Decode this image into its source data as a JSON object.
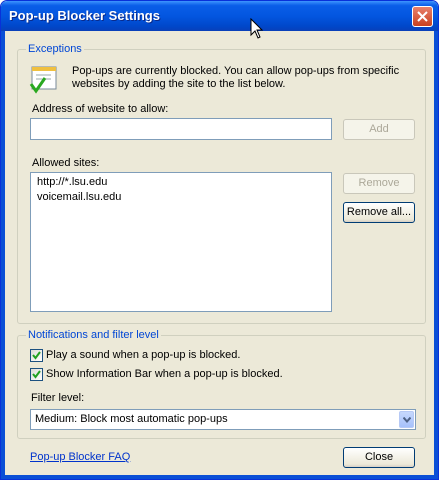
{
  "window": {
    "title": "Pop-up Blocker Settings"
  },
  "exceptions": {
    "legend": "Exceptions",
    "description_line1": "Pop-ups are currently blocked.  You can allow pop-ups from specific",
    "description_line2": "websites by adding the site to the list below.",
    "address_label": "Address of website to allow:",
    "address_value": "",
    "add_button": "Add",
    "allowed_label": "Allowed sites:",
    "allowed_sites": [
      "http://*.lsu.edu",
      "voicemail.lsu.edu"
    ],
    "remove_button": "Remove",
    "remove_all_button": "Remove all..."
  },
  "notifications": {
    "legend": "Notifications and filter level",
    "play_sound_label": "Play a sound when a pop-up is blocked.",
    "play_sound_checked": true,
    "info_bar_label": "Show Information Bar when a pop-up is blocked.",
    "info_bar_checked": true,
    "filter_label": "Filter level:",
    "filter_value": "Medium: Block most automatic pop-ups"
  },
  "footer": {
    "faq_link": "Pop-up Blocker FAQ",
    "close_button": "Close"
  },
  "colors": {
    "title_bar": "#0356e0",
    "face": "#ece9d8",
    "legend_text": "#0046d5",
    "link": "#0033cc"
  }
}
